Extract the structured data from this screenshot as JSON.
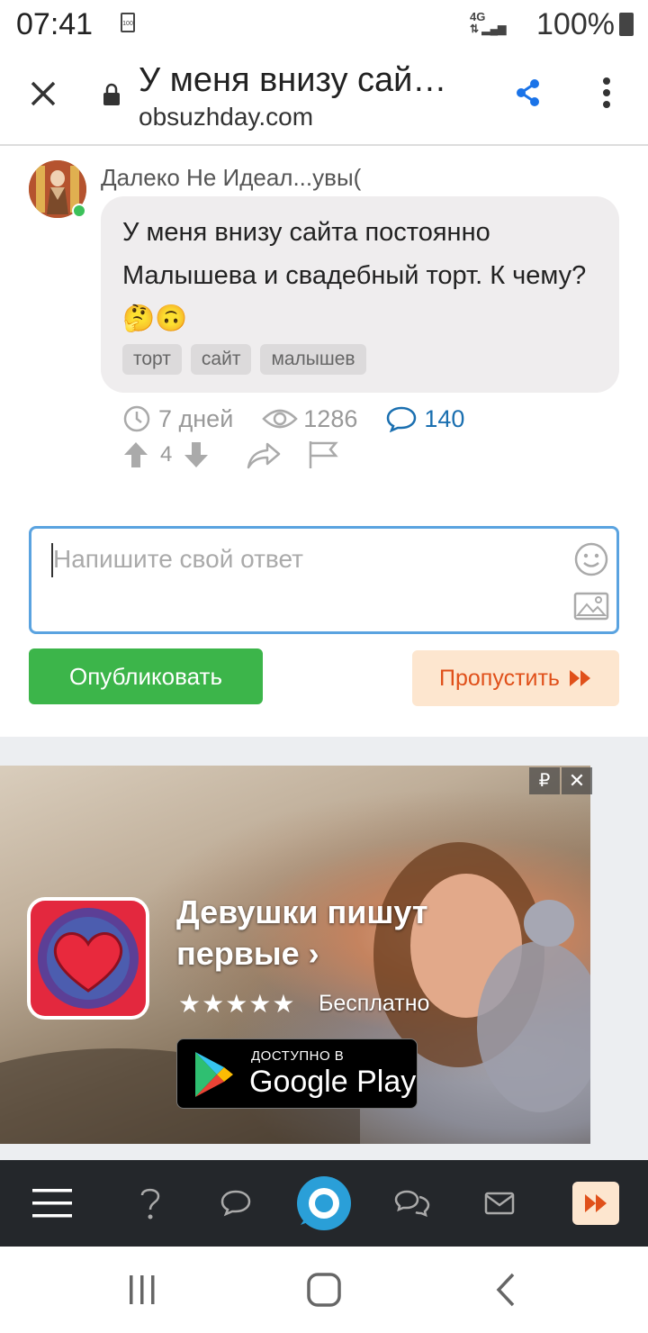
{
  "status_bar": {
    "time": "07:41",
    "small_battery_label": "100",
    "network": "4G",
    "battery_percent": "100%"
  },
  "browser": {
    "page_title": "У меня внизу сай…",
    "url": "obsuzhday.com",
    "icons": [
      "close-icon",
      "lock-icon",
      "share-icon",
      "more-vert-icon"
    ],
    "accent": "#1a73e8"
  },
  "post": {
    "author": "Далеко Не Идеал...увы(",
    "question": "У меня внизу сайта постоянно Малышева и свадебный торт. К чему?🤔🙃",
    "tags": [
      "торт",
      "сайт",
      "малышев"
    ],
    "age": "7 дней",
    "views": "1286",
    "comments": "140",
    "rating": "4"
  },
  "answer": {
    "placeholder": "Напишите свой ответ",
    "publish_label": "Опубликовать",
    "skip_label": "Пропустить",
    "publish_color": "#3cb54a",
    "skip_color": "#e0501a"
  },
  "ad": {
    "currency_badge": "₽",
    "close_label": "✕",
    "title": "Девушки пишут первые ›",
    "stars": "★★★★★",
    "price": "Бесплатно",
    "store_small": "ДОСТУПНО В",
    "store_big": "Google Play"
  },
  "bottom_nav": {
    "items": [
      "menu-icon",
      "question-icon",
      "chat-icon",
      "home-logo-icon",
      "chats-icon",
      "mail-icon",
      "skip-icon"
    ]
  },
  "system_nav": {
    "items": [
      "recent-apps-icon",
      "home-icon",
      "back-icon"
    ]
  }
}
